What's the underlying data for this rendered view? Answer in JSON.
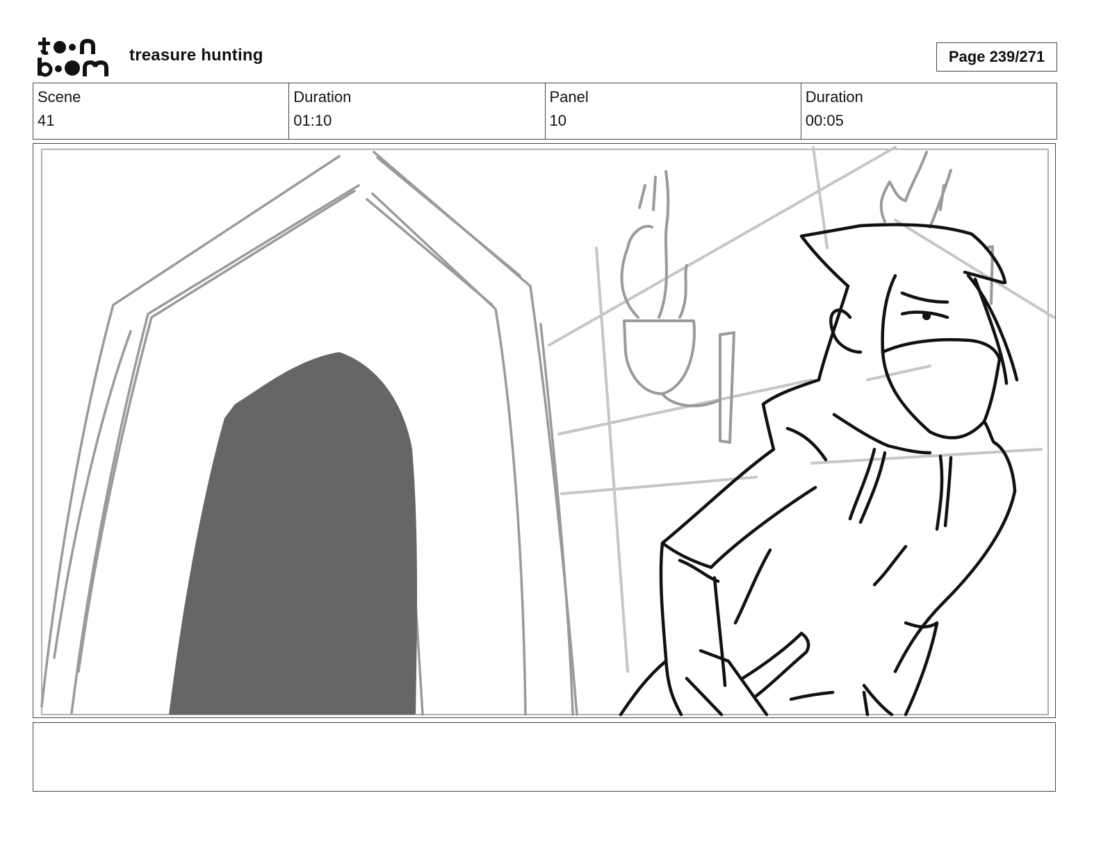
{
  "header": {
    "logo_alt": "toon boom",
    "project_title": "treasure hunting",
    "page_label": "Page 239/271"
  },
  "info": [
    {
      "label": "Scene",
      "value": "41"
    },
    {
      "label": "Duration",
      "value": "01:10"
    },
    {
      "label": "Panel",
      "value": "10"
    },
    {
      "label": "Duration",
      "value": "00:05"
    }
  ],
  "notes": {
    "text": ""
  },
  "colors": {
    "sketch_gray": "#9a9a9a",
    "sketch_light": "#c6c6c6",
    "doorway_fill": "#666666",
    "ink": "#111111"
  }
}
